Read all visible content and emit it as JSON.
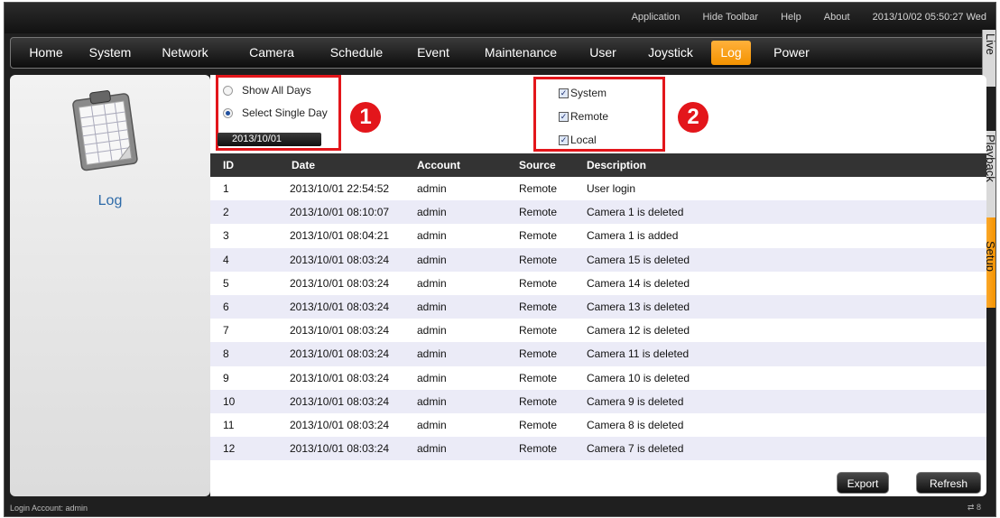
{
  "topbar": {
    "links": [
      "Application",
      "Hide Toolbar",
      "Help",
      "About"
    ],
    "clock": "2013/10/02 05:50:27 Wed"
  },
  "nav": {
    "items": [
      "Home",
      "System",
      "Network",
      "Camera",
      "Schedule",
      "Event",
      "Maintenance",
      "User",
      "Joystick",
      "Log",
      "Power"
    ],
    "active": "Log"
  },
  "side_tabs": [
    "Live",
    "Playback",
    "Setup"
  ],
  "left_panel": {
    "icon": "clipboard-icon",
    "label": "Log"
  },
  "filters": {
    "show_all_days": "Show All Days",
    "select_single_day": "Select Single Day",
    "selected_mode": "Select Single Day",
    "date": "2013/10/01",
    "sources": [
      {
        "label": "System",
        "checked": true
      },
      {
        "label": "Remote",
        "checked": true
      },
      {
        "label": "Local",
        "checked": true
      }
    ],
    "badge1": "1",
    "badge2": "2"
  },
  "table": {
    "headers": [
      "ID",
      "Date",
      "Account",
      "Source",
      "Description"
    ],
    "rows": [
      [
        "1",
        "2013/10/01 22:54:52",
        "admin",
        "Remote",
        "User login"
      ],
      [
        "2",
        "2013/10/01 08:10:07",
        "admin",
        "Remote",
        "Camera 1 is deleted"
      ],
      [
        "3",
        "2013/10/01 08:04:21",
        "admin",
        "Remote",
        "Camera 1 is added"
      ],
      [
        "4",
        "2013/10/01 08:03:24",
        "admin",
        "Remote",
        "Camera 15 is deleted"
      ],
      [
        "5",
        "2013/10/01 08:03:24",
        "admin",
        "Remote",
        "Camera 14 is deleted"
      ],
      [
        "6",
        "2013/10/01 08:03:24",
        "admin",
        "Remote",
        "Camera 13 is deleted"
      ],
      [
        "7",
        "2013/10/01 08:03:24",
        "admin",
        "Remote",
        "Camera 12 is deleted"
      ],
      [
        "8",
        "2013/10/01 08:03:24",
        "admin",
        "Remote",
        "Camera 11 is deleted"
      ],
      [
        "9",
        "2013/10/01 08:03:24",
        "admin",
        "Remote",
        "Camera 10 is deleted"
      ],
      [
        "10",
        "2013/10/01 08:03:24",
        "admin",
        "Remote",
        "Camera 9 is deleted"
      ],
      [
        "11",
        "2013/10/01 08:03:24",
        "admin",
        "Remote",
        "Camera 8 is deleted"
      ],
      [
        "12",
        "2013/10/01 08:03:24",
        "admin",
        "Remote",
        "Camera 7 is deleted"
      ]
    ]
  },
  "buttons": {
    "export": "Export",
    "refresh": "Refresh"
  },
  "status": {
    "login": "Login Account: admin",
    "right": "8",
    "right_icon": "network-icon"
  },
  "colors": {
    "accent": "#f39200",
    "highlight": "#e3161b",
    "link": "#2d6aa8"
  }
}
